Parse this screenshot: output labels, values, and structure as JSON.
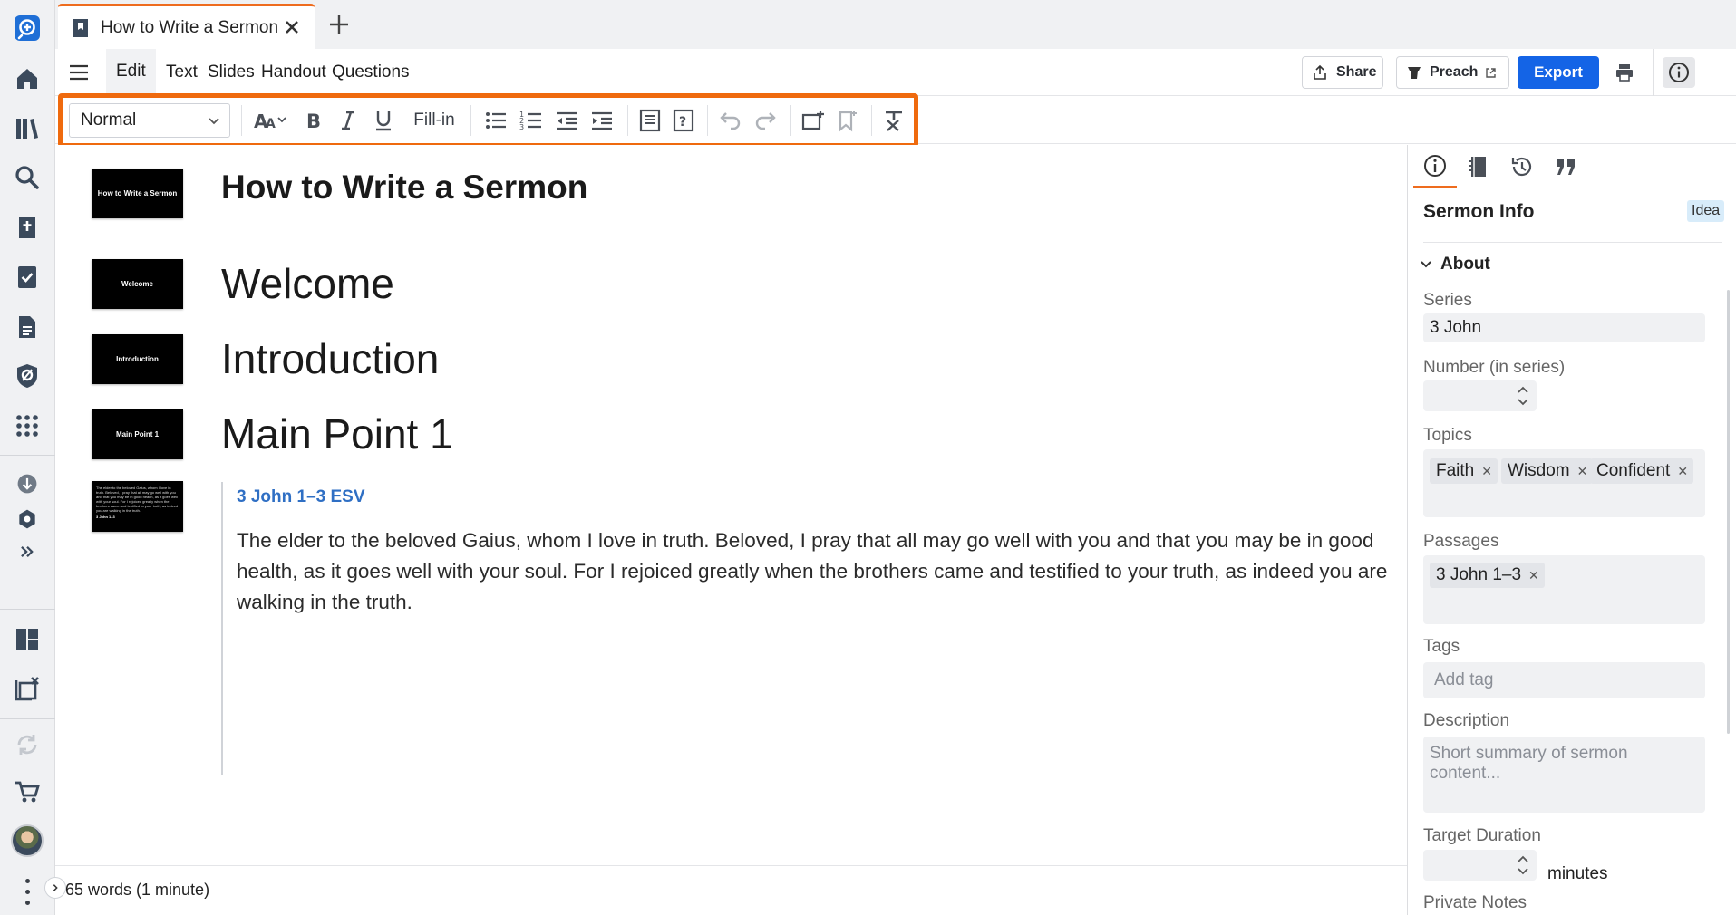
{
  "tab": {
    "title": "How to Write a Sermon"
  },
  "menu": {
    "items": [
      "Edit",
      "Text",
      "Slides",
      "Handout",
      "Questions"
    ],
    "active": "Edit"
  },
  "actions": {
    "share": "Share",
    "preach": "Preach",
    "export": "Export"
  },
  "toolbar": {
    "style_value": "Normal",
    "fill_in": "Fill-in",
    "highlight_color": "#ef6a0e"
  },
  "document": {
    "title": "How to Write a Sermon",
    "sections": [
      "Welcome",
      "Introduction",
      "Main Point 1"
    ],
    "thumbnails": [
      "How to Write a Sermon",
      "Welcome",
      "Introduction",
      "Main Point 1"
    ],
    "scripture": {
      "reference": "3 John 1–3 ESV",
      "text": "The elder to the beloved Gaius, whom I love in truth. Beloved, I pray that all may go well with you and that you may be in good health, as it goes well with your soul. For I rejoiced greatly when the brothers came and testified to your truth, as indeed you are walking in the truth.",
      "thumb_text": "The elder to the beloved Gaius, whom I love in truth. Beloved, I pray that all may go well with you and that you may be in good health, as it goes well with your soul. For I rejoiced greatly when the brothers came and testified to your truth, as indeed you are walking in the truth.",
      "thumb_ref": "3 John 1–3"
    }
  },
  "status": {
    "word_count": "65 words (1 minute)"
  },
  "panel": {
    "title": "Sermon Info",
    "badge": "Idea",
    "section": "About",
    "series_label": "Series",
    "series_value": "3 John",
    "number_label": "Number (in series)",
    "topics_label": "Topics",
    "topics": [
      "Faith",
      "Wisdom",
      "Confident"
    ],
    "passages_label": "Passages",
    "passages": [
      "3 John 1–3"
    ],
    "tags_label": "Tags",
    "tags_placeholder": "Add tag",
    "description_label": "Description",
    "description_placeholder": "Short summary of sermon content...",
    "duration_label": "Target Duration",
    "duration_unit": "minutes",
    "notes_label": "Private Notes"
  },
  "colors": {
    "accent": "#ee6c1e",
    "primary": "#1464e6",
    "link": "#2f6fc4",
    "rail_icon": "#3b4a5c"
  },
  "icons": {
    "rail": [
      "logos-logo-icon",
      "home-icon",
      "library-icon",
      "search-icon",
      "sermon-icon",
      "checklist-icon",
      "document-icon",
      "factbook-icon",
      "apps-icon",
      "download-icon",
      "settings-icon",
      "expand-icon",
      "layout-icon",
      "close-panels-icon",
      "sync-icon",
      "cart-icon"
    ]
  }
}
